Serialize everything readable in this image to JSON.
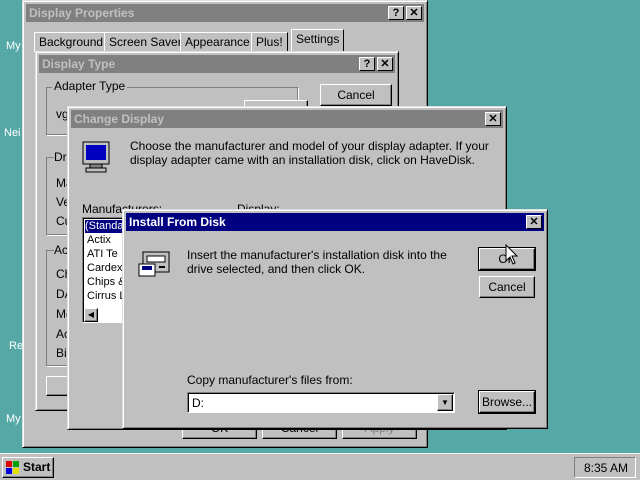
{
  "desktop": {
    "labels": [
      "My",
      "Nei",
      "Re",
      "My"
    ]
  },
  "display_properties": {
    "title": "Display Properties",
    "tabs": [
      "Background",
      "Screen Saver",
      "Appearance",
      "Plus!",
      "Settings"
    ],
    "buttons": [
      "OK",
      "Cancel",
      "Apply"
    ]
  },
  "display_type": {
    "title": "Display Type",
    "adapter_group": "Adapter Type",
    "adapter_value": "vg",
    "cancel_label": "Cancel",
    "driver_group": "Dr",
    "driver_rows": [
      "Ma",
      "Ve",
      "Cu"
    ],
    "adapter_rows_group": "Ac",
    "adapter_rows": [
      "Ch",
      "DA",
      "Me",
      "Ac",
      "Bio"
    ]
  },
  "change_display": {
    "title": "Change Display",
    "instructions": "Choose the manufacturer and model of your display adapter.  If your display adapter came with an installation disk, click on HaveDisk.",
    "manufacturers_label": "Manufacturers:",
    "display_label": "Display:",
    "manufacturers": [
      "(Standa",
      "Actix",
      "ATI Te",
      "Cardex",
      "Chips &",
      "Cirrus L"
    ]
  },
  "install_from_disk": {
    "title": "Install From Disk",
    "message": "Insert the manufacturer's installation disk into the drive selected, and then click OK.",
    "ok_label": "OK",
    "cancel_label": "Cancel",
    "browse_label": "Browse...",
    "copy_label": "Copy manufacturer's files from:",
    "copy_value": "D:"
  },
  "taskbar": {
    "start_label": "Start",
    "clock": "8:35 AM"
  },
  "colors": {
    "desktop": "#55a8a6",
    "active_title": "#000080",
    "inactive_title": "#808080",
    "face": "#c0c0c0"
  }
}
